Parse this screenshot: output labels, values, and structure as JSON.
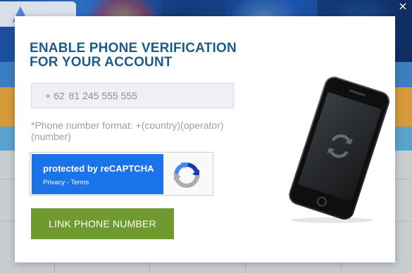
{
  "modal": {
    "title_line1": "ENABLE PHONE VERIFICATION",
    "title_line2": "FOR YOUR ACCOUNT",
    "phone": {
      "prefix": "+ 62",
      "placeholder": "81 245 555 555"
    },
    "hint": "*Phone number format: +(country)(operator)(number)",
    "recaptcha": {
      "text": "protected by reCAPTCHA",
      "privacy_link": "Privacy",
      "separator": " - ",
      "terms_link": "Terms"
    },
    "button_label": "LINK PHONE NUMBER",
    "illustration_icon": "phone-sync-icon"
  },
  "close_icon": "×",
  "colors": {
    "title": "#1f5b8a",
    "button": "#6f9a2f",
    "recaptcha_blue": "#1a73e8"
  }
}
